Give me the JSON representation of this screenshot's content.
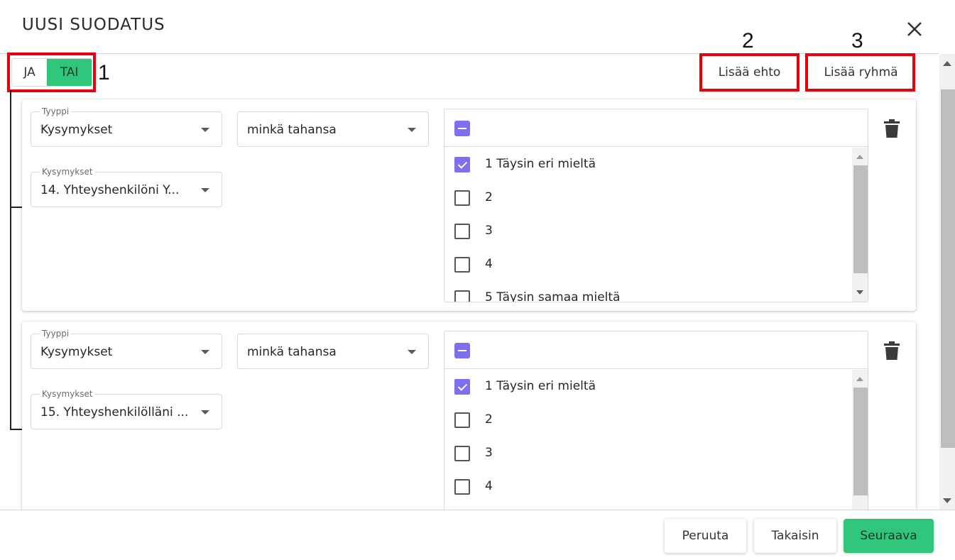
{
  "dialog": {
    "title": "UUSI SUODATUS"
  },
  "logic_toggle": {
    "ja_label": "JA",
    "tai_label": "TAI",
    "selected": "TAI",
    "selected_color": "#2fc57b"
  },
  "toolbar": {
    "add_condition_label": "Lisää ehto",
    "add_group_label": "Lisää ryhmä"
  },
  "annotations": {
    "one": "1",
    "two": "2",
    "three": "3",
    "box_color": "#e8000d"
  },
  "conditions": [
    {
      "type_label": "Tyyppi",
      "type_value": "Kysymykset",
      "operator_value": "minkä tahansa",
      "question_label": "Kysymykset",
      "question_value": "14. Yhteyshenkilöni Y...",
      "options": [
        {
          "label": "1 Täysin eri mieltä",
          "checked": true
        },
        {
          "label": "2",
          "checked": false
        },
        {
          "label": "3",
          "checked": false
        },
        {
          "label": "4",
          "checked": false
        },
        {
          "label": "5 Täysin samaa mieltä",
          "checked": false
        }
      ]
    },
    {
      "type_label": "Tyyppi",
      "type_value": "Kysymykset",
      "operator_value": "minkä tahansa",
      "question_label": "Kysymykset",
      "question_value": "15. Yhteyshenkilölläni ...",
      "options": [
        {
          "label": "1 Täysin eri mieltä",
          "checked": true
        },
        {
          "label": "2",
          "checked": false
        },
        {
          "label": "3",
          "checked": false
        },
        {
          "label": "4",
          "checked": false
        }
      ]
    }
  ],
  "footer": {
    "cancel_label": "Peruuta",
    "back_label": "Takaisin",
    "next_label": "Seuraava"
  },
  "colors": {
    "accent_purple": "#7e6ef0",
    "primary_green": "#2fc57b"
  }
}
